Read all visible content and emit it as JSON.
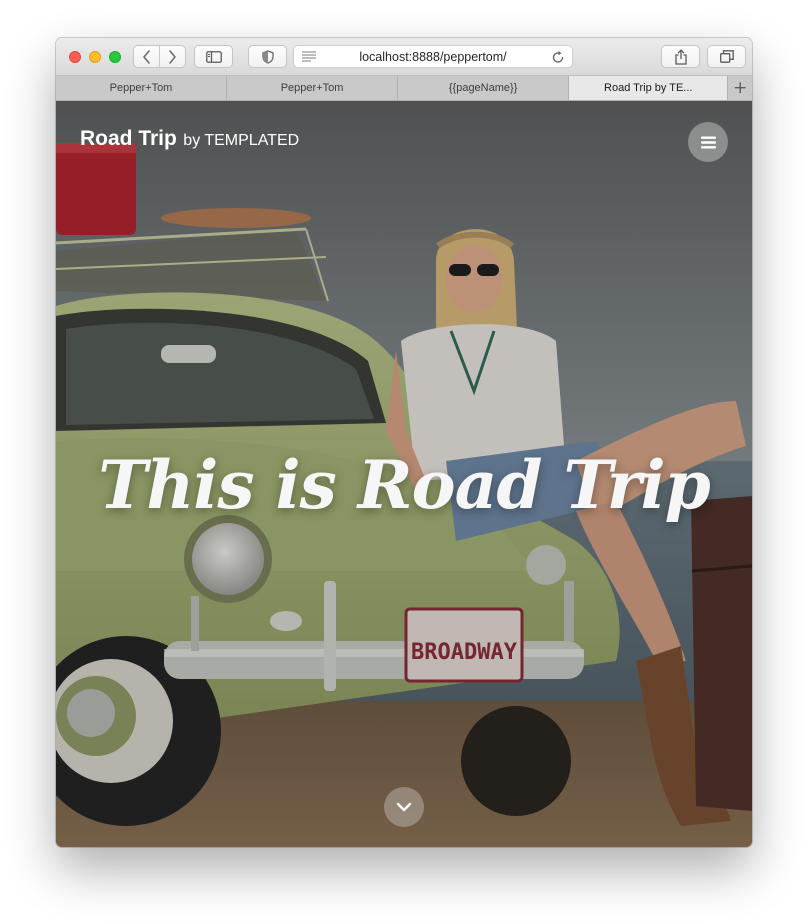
{
  "browser": {
    "url": "localhost:8888/peppertom/",
    "tabs": [
      {
        "label": "Pepper+Tom",
        "active": false
      },
      {
        "label": "Pepper+Tom",
        "active": false
      },
      {
        "label": "{{pageName}}",
        "active": false
      },
      {
        "label": "Road Trip by TE...",
        "active": true
      }
    ],
    "new_tab_label": "+"
  },
  "page": {
    "logo_brand": "Road Trip",
    "logo_by": "by TEMPLATED",
    "headline": "This is Road Trip",
    "license_plate": "BROADWAY"
  },
  "icons": {
    "back": "chevron-left-icon",
    "forward": "chevron-right-icon",
    "sidebar": "sidebar-icon",
    "privacy": "shield-icon",
    "reader": "reader-icon",
    "reload": "reload-icon",
    "share": "share-icon",
    "tabs": "tab-overview-icon",
    "menu": "hamburger-menu-icon",
    "scroll": "chevron-down-icon"
  },
  "colors": {
    "close": "#fc5f57",
    "minimize": "#fdbd2e",
    "maximize": "#28c840",
    "car_body": "#a8b77a",
    "suitcase": "#c4232e",
    "sky": "#8f9aa0",
    "ground": "#7d6445"
  }
}
